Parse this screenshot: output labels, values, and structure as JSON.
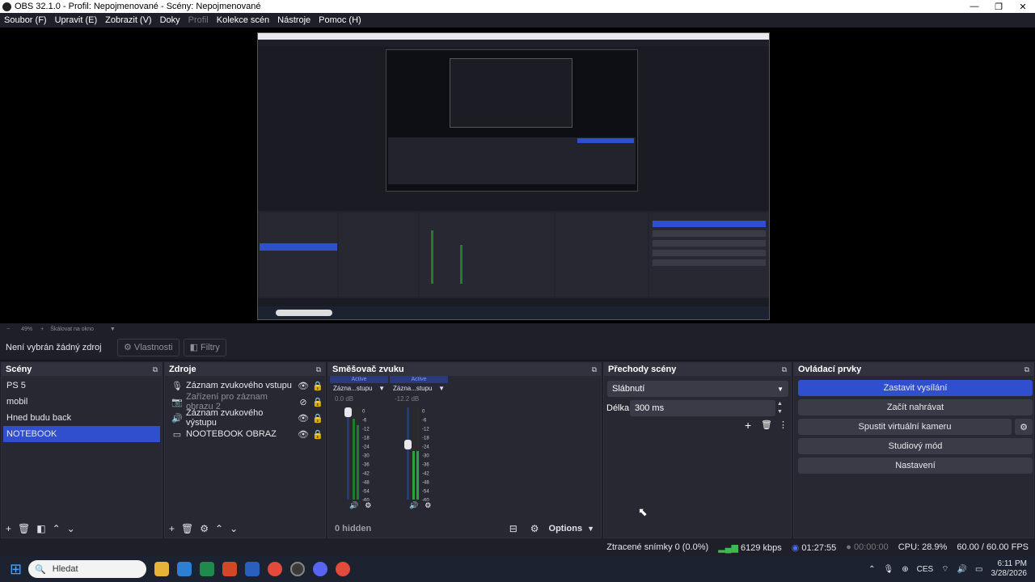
{
  "window": {
    "title": "OBS 32.1.0 - Profil: Nepojmenované - Scény: Nepojmenované"
  },
  "menu": [
    {
      "label": "Soubor (F)",
      "dim": false
    },
    {
      "label": "Upravit (E)",
      "dim": false
    },
    {
      "label": "Zobrazit (V)",
      "dim": false
    },
    {
      "label": "Doky",
      "dim": false
    },
    {
      "label": "Profil",
      "dim": true
    },
    {
      "label": "Kolekce scén",
      "dim": false
    },
    {
      "label": "Nástroje",
      "dim": false
    },
    {
      "label": "Pomoc (H)",
      "dim": false
    }
  ],
  "preview_bar": {
    "zoom": "49%",
    "scale": "Škálovat na okno"
  },
  "context_bar": {
    "no_source": "Není vybrán žádný zdroj",
    "properties": "Vlastnosti",
    "filters": "Filtry"
  },
  "scenes": {
    "title": "Scény",
    "items": [
      "PS 5",
      "mobil",
      "Hned budu back",
      "NOTEBOOK"
    ],
    "selected_index": 3
  },
  "sources": {
    "title": "Zdroje",
    "items": [
      {
        "label": "Záznam zvukového vstupu",
        "icon": "microphone-icon",
        "dim": false
      },
      {
        "label": "Zařízení pro záznam obrazu 2",
        "icon": "camera-icon",
        "dim": true
      },
      {
        "label": "Záznam zvukového výstupu",
        "icon": "speaker-icon",
        "dim": false
      },
      {
        "label": "NOOTEBOOK OBRAZ",
        "icon": "monitor-icon",
        "dim": false
      }
    ]
  },
  "mixer": {
    "title": "Směšovač zvuku",
    "channels": [
      {
        "active": "Active",
        "name": "Zázna...stupu",
        "db": "0.0 dB",
        "volume": 1.0
      },
      {
        "active": "Active",
        "name": "Zázna...stupu",
        "db": "-12.2 dB",
        "volume": 0.6
      }
    ],
    "scale": [
      "0",
      "-6",
      "-12",
      "-18",
      "-24",
      "-30",
      "-36",
      "-42",
      "-48",
      "-54",
      "-60"
    ],
    "hidden": "0 hidden",
    "options": "Options"
  },
  "transitions": {
    "title": "Přechody scény",
    "selected": "Slábnutí",
    "duration_label": "Délka",
    "duration": "300 ms"
  },
  "controls": {
    "title": "Ovládací prvky",
    "stop_stream": "Zastavit vysílání",
    "start_record": "Začít nahrávat",
    "virtual_cam": "Spustit virtuální kameru",
    "studio_mode": "Studiový mód",
    "settings": "Nastavení"
  },
  "status": {
    "dropped": "Ztracené snímky 0 (0.0%)",
    "bitrate": "6129 kbps",
    "stream_time": "01:27:55",
    "rec_time": "00:00:00",
    "cpu": "CPU: 28.9%",
    "fps": "60.00 / 60.00 FPS"
  },
  "taskbar": {
    "search_placeholder": "Hledat",
    "lang": "CES",
    "time": "6:11 PM",
    "date": "3/28/2026"
  },
  "colors": {
    "accent": "#2f4fcf",
    "panel": "#272832",
    "bg": "#1e1f29"
  }
}
